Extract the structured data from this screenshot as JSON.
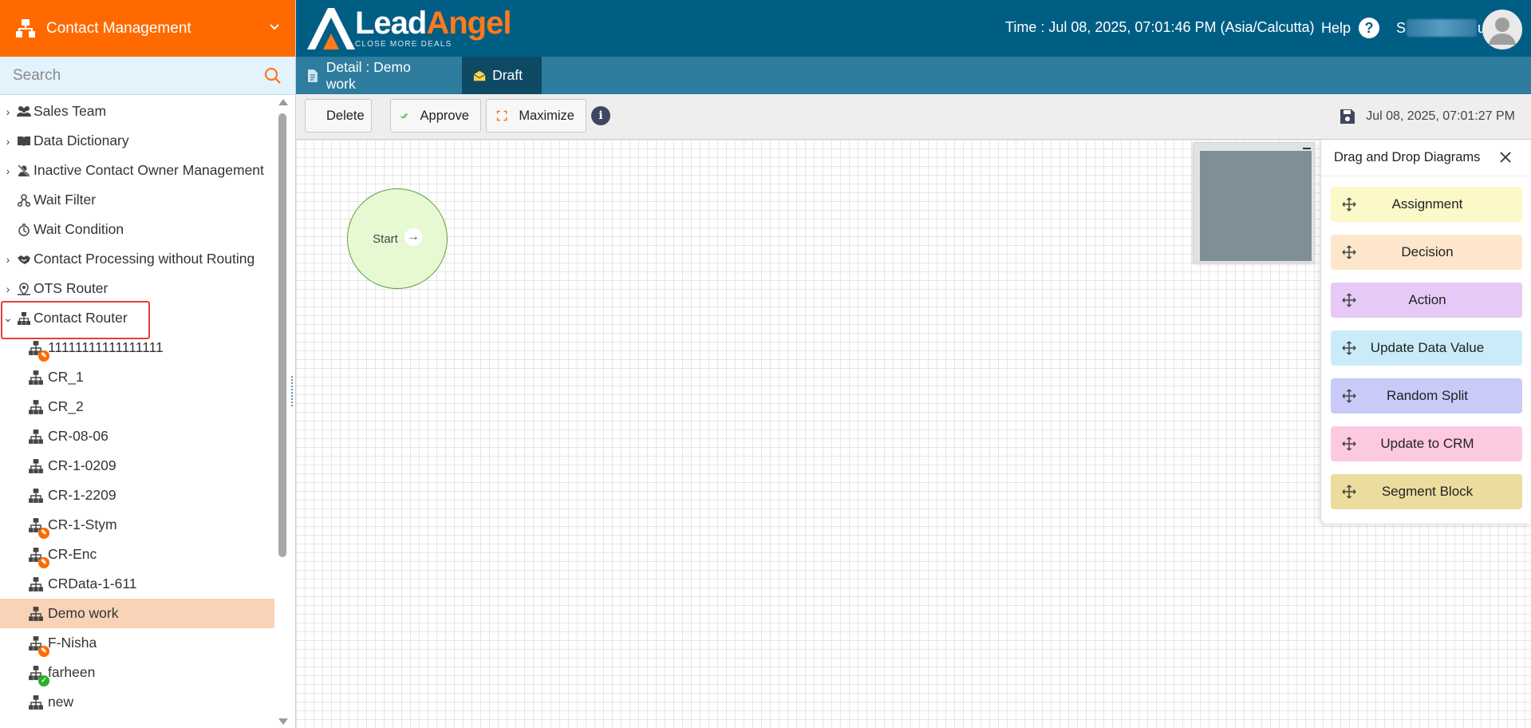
{
  "module": {
    "title": "Contact Management"
  },
  "search": {
    "placeholder": "Search"
  },
  "tree": {
    "items": [
      {
        "label": "Sales Team"
      },
      {
        "label": "Data Dictionary"
      },
      {
        "label": "Inactive Contact Owner Management"
      },
      {
        "label": "Wait Filter"
      },
      {
        "label": "Wait Condition"
      },
      {
        "label": "Contact Processing without Routing"
      },
      {
        "label": "OTS Router"
      },
      {
        "label": "Contact Router"
      }
    ],
    "children": [
      {
        "label": "11111111111111111",
        "badge": "edit"
      },
      {
        "label": "CR_1"
      },
      {
        "label": "CR_2"
      },
      {
        "label": "CR-08-06"
      },
      {
        "label": "CR-1-0209"
      },
      {
        "label": "CR-1-2209"
      },
      {
        "label": "CR-1-Stym",
        "badge": "edit"
      },
      {
        "label": "CR-Enc",
        "badge": "edit"
      },
      {
        "label": "CRData-1-611"
      },
      {
        "label": "Demo work",
        "selected": true
      },
      {
        "label": "F-Nisha",
        "badge": "edit"
      },
      {
        "label": "farheen",
        "badge": "ok"
      },
      {
        "label": "new"
      }
    ]
  },
  "header": {
    "brand_lead": "Lead",
    "brand_angel": "Angel",
    "brand_tagline": "CLOSE MORE DEALS",
    "time": "Time : Jul 08, 2025, 07:01:46 PM (Asia/Calcutta)",
    "help": "Help",
    "user_first": "S",
    "user_last": "u"
  },
  "tabs": {
    "detail": "Detail : Demo work",
    "draft": "Draft"
  },
  "toolbar": {
    "delete": "Delete",
    "approve": "Approve",
    "maximize": "Maximize",
    "saved_at": "Jul 08, 2025, 07:01:27 PM"
  },
  "canvas": {
    "start_label": "Start"
  },
  "palette": {
    "title": "Drag and Drop Diagrams",
    "items": [
      {
        "label": "Assignment",
        "color": "#fdf8c8"
      },
      {
        "label": "Decision",
        "color": "#fde6cc"
      },
      {
        "label": "Action",
        "color": "#e6c9f7"
      },
      {
        "label": "Update Data Value",
        "color": "#c9ecf8"
      },
      {
        "label": "Random Split",
        "color": "#c9caf7"
      },
      {
        "label": "Update to CRM",
        "color": "#fcc9e1"
      },
      {
        "label": "Segment Block",
        "color": "#ecdc9e"
      }
    ]
  },
  "colors": {
    "module_orange": "#ff6a00",
    "topbar_blue": "#005e85",
    "tab_blue": "#2e7c9e",
    "selected_row": "#f8d3b7"
  }
}
